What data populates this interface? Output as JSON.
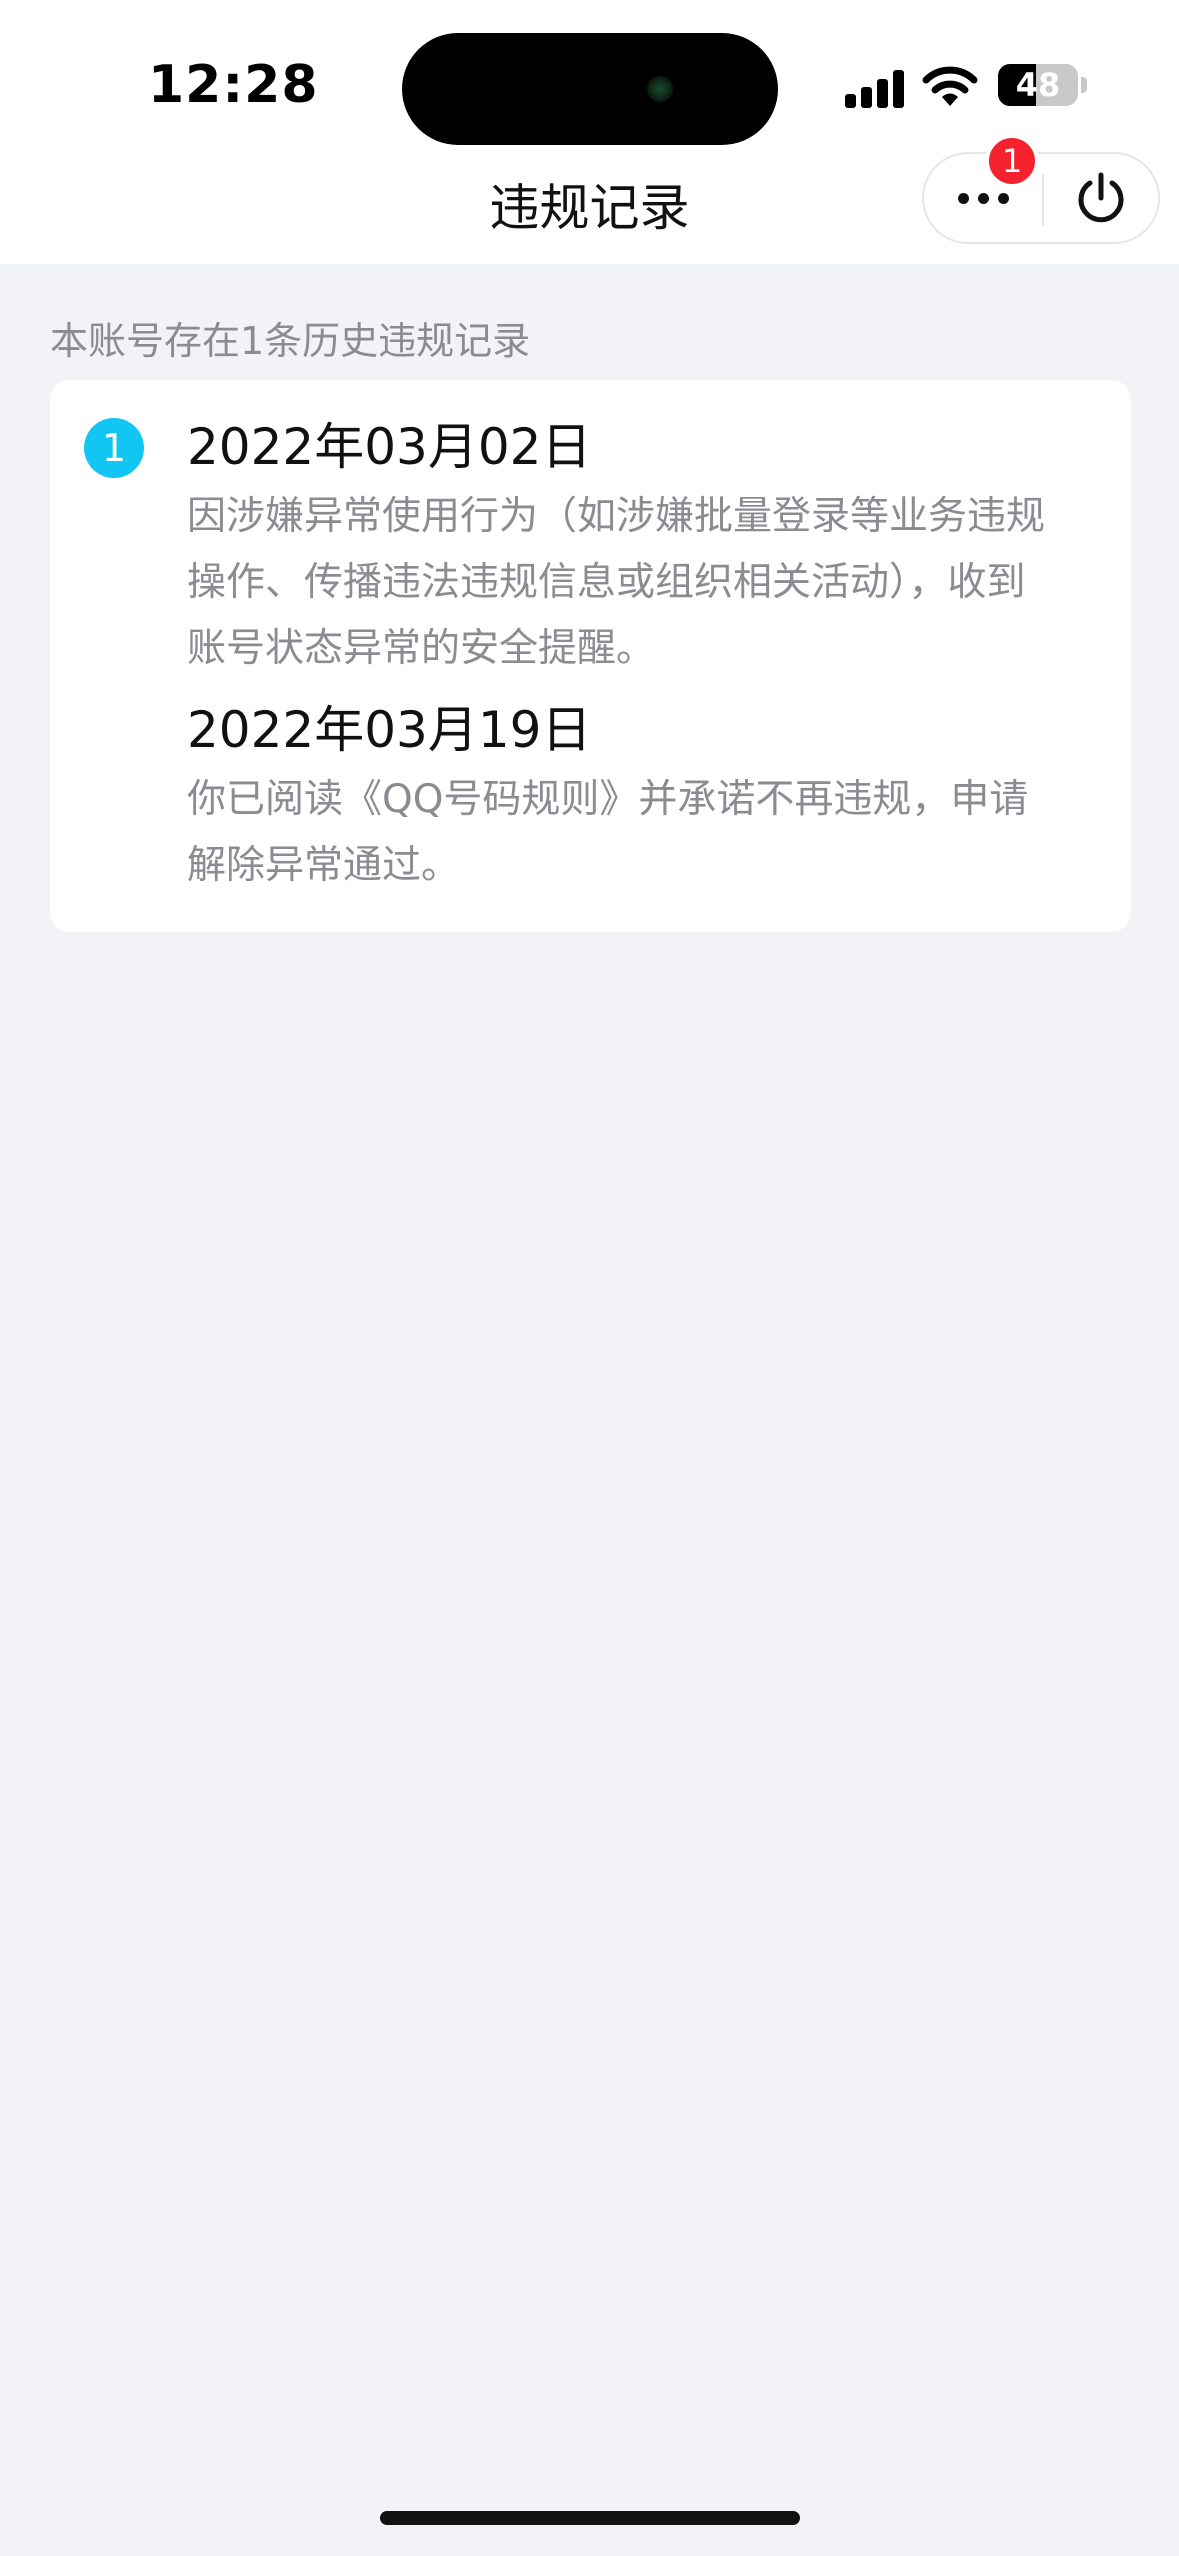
{
  "status_bar": {
    "time": "12:28",
    "battery_level": "48",
    "battery_fraction": 0.48,
    "signal_icon": "cellular-signal-icon",
    "wifi_icon": "wifi-icon"
  },
  "nav": {
    "title": "违规记录",
    "more_icon": "more-dots-icon",
    "power_icon": "power-icon",
    "badge_count": "1"
  },
  "summary_text": "本账号存在1条历史违规记录",
  "records": [
    {
      "index": "1",
      "entries": [
        {
          "date": "2022年03月02日",
          "lines": [
            "因涉嫌异常使用行为（如涉嫌批量登录等业务违规",
            "操作、传播违法违规信息或组织相关活动），收到",
            "账号状态异常的安全提醒。"
          ]
        },
        {
          "date": "2022年03月19日",
          "lines": [
            "你已阅读《QQ号码规则》并承诺不再违规，申请",
            "解除异常通过。"
          ]
        }
      ]
    }
  ],
  "colors": {
    "page_background": "#f2f3f7",
    "accent_blue": "#12c6f3",
    "badge_red": "#f5222d",
    "secondary_text": "#8a8c92"
  }
}
